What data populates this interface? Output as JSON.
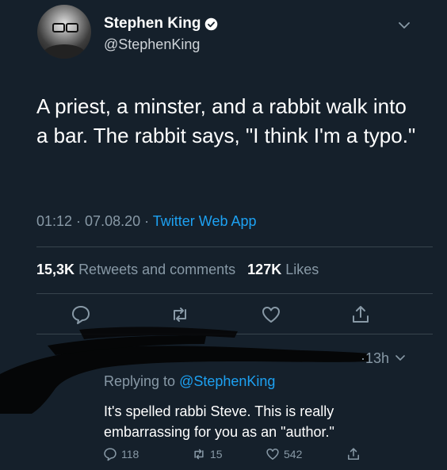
{
  "tweet": {
    "author": {
      "display_name": "Stephen King",
      "handle": "@StephenKing",
      "verified": true
    },
    "text": "A priest, a minster, and a rabbit walk into a bar. The rabbit says, \"I think I'm a typo.\"",
    "time": "01:12",
    "date": "07.08.20",
    "separator": " · ",
    "app": "Twitter Web App",
    "stats": {
      "retweets_count": "15,3K",
      "retweets_label": "Retweets and comments",
      "likes_count": "127K",
      "likes_label": "Likes"
    }
  },
  "reply": {
    "age": "·13h",
    "replying_prefix": "Replying to ",
    "replying_to": "@StephenKing",
    "text": "It's spelled rabbi Steve. This is really embarrassing for you as an \"author.\"",
    "replies": "118",
    "retweets": "15",
    "likes": "542"
  },
  "colors": {
    "background": "#15202b",
    "accent": "#1da1f2",
    "muted": "#8899a6",
    "divider": "#38444d"
  },
  "icons": {
    "verified": "verified-badge-icon",
    "more": "chevron-down-icon",
    "reply": "comment-bubble-icon",
    "retweet": "retweet-icon",
    "like": "heart-icon",
    "share": "share-icon"
  }
}
